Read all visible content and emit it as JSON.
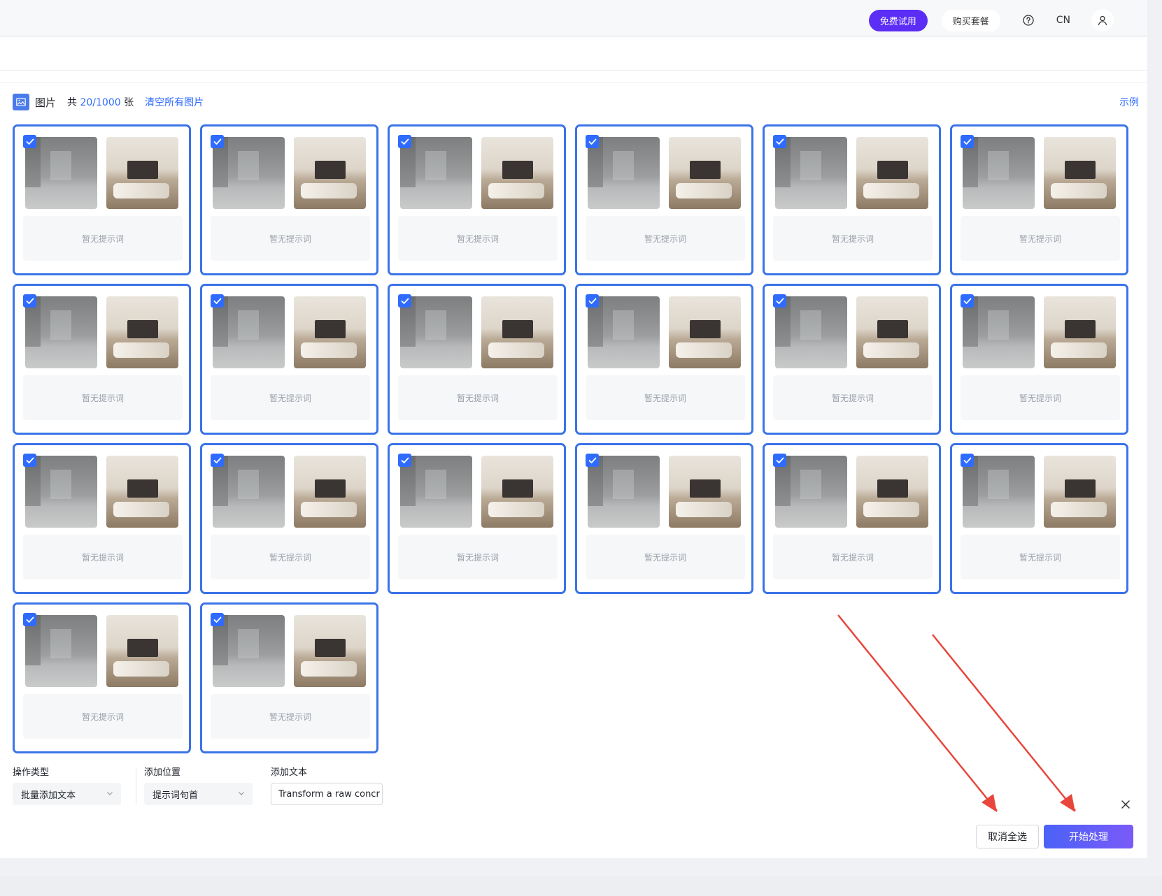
{
  "header": {
    "trial_label": "免费试用",
    "buy_label": "购买套餐",
    "lang_label": "CN",
    "help_icon": "question-circle-icon",
    "user_icon": "user-icon"
  },
  "images_panel": {
    "title": "图片",
    "count_prefix": "共",
    "count_value": "20/1000",
    "count_suffix": "张",
    "clear_all_label": "清空所有图片",
    "example_label": "示例"
  },
  "cards": [
    {
      "prompt": "暂无提示词",
      "checked": true
    },
    {
      "prompt": "暂无提示词",
      "checked": true
    },
    {
      "prompt": "暂无提示词",
      "checked": true
    },
    {
      "prompt": "暂无提示词",
      "checked": true
    },
    {
      "prompt": "暂无提示词",
      "checked": true
    },
    {
      "prompt": "暂无提示词",
      "checked": true
    },
    {
      "prompt": "暂无提示词",
      "checked": true
    },
    {
      "prompt": "暂无提示词",
      "checked": true
    },
    {
      "prompt": "暂无提示词",
      "checked": true
    },
    {
      "prompt": "暂无提示词",
      "checked": true
    },
    {
      "prompt": "暂无提示词",
      "checked": true
    },
    {
      "prompt": "暂无提示词",
      "checked": true
    },
    {
      "prompt": "暂无提示词",
      "checked": true
    },
    {
      "prompt": "暂无提示词",
      "checked": true
    },
    {
      "prompt": "暂无提示词",
      "checked": true
    },
    {
      "prompt": "暂无提示词",
      "checked": true
    },
    {
      "prompt": "暂无提示词",
      "checked": true
    },
    {
      "prompt": "暂无提示词",
      "checked": true
    },
    {
      "prompt": "暂无提示词",
      "checked": true
    },
    {
      "prompt": "暂无提示词",
      "checked": true
    }
  ],
  "form": {
    "operation_type_label": "操作类型",
    "operation_type_value": "批量添加文本",
    "position_label": "添加位置",
    "position_value": "提示词句首",
    "text_label": "添加文本",
    "text_value": "Transform a raw concr"
  },
  "actions": {
    "cancel_label": "取消全选",
    "start_label": "开始处理"
  },
  "colors": {
    "accent": "#2f6bff",
    "card_border": "#3b73e8",
    "trial_bg": "#5b2df5",
    "annotation_arrow": "#e8463c"
  }
}
